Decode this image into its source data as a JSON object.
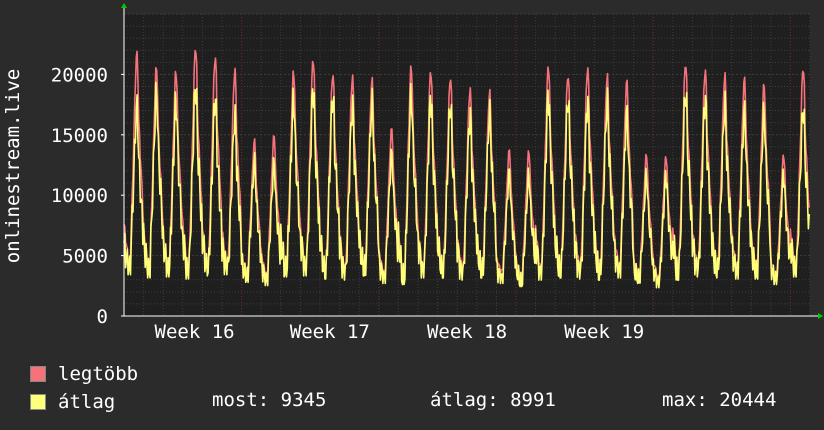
{
  "chart_data": {
    "type": "line",
    "ylabel": "onlinestream.live",
    "ylim": [
      0,
      25000
    ],
    "yticks": [
      0,
      5000,
      10000,
      15000,
      20000
    ],
    "x_tick_labels": [
      "Week 16",
      "Week 17",
      "Week 18",
      "Week 19"
    ],
    "grid": true,
    "days": 35,
    "series": [
      {
        "name": "legtöbb",
        "color": "#f5727b",
        "daily_peaks": [
          21700,
          20500,
          20200,
          22300,
          21500,
          20300,
          14500,
          14900,
          20200,
          21300,
          20100,
          19800,
          19500,
          15500,
          20600,
          20300,
          19800,
          18800,
          18500,
          13700,
          13600,
          20700,
          20000,
          20500,
          19800,
          19400,
          13300,
          13200,
          21000,
          20400,
          19900,
          19600,
          19100,
          13300,
          20600
        ],
        "daily_lows": [
          4500,
          4200,
          4100,
          4000,
          4300,
          4400,
          3700,
          3400,
          4200,
          4300,
          4000,
          3900,
          4400,
          3600,
          3500,
          4100,
          4200,
          4000,
          4200,
          3700,
          3300,
          4000,
          4100,
          4100,
          4000,
          4200,
          3600,
          3200,
          4000,
          4300,
          4200,
          4100,
          4100,
          3500,
          4200
        ]
      },
      {
        "name": "átlag",
        "color": "#ffff7a",
        "daily_peaks": [
          17300,
          18300,
          17600,
          19000,
          18100,
          16500,
          12700,
          12500,
          17800,
          18800,
          18200,
          17400,
          17600,
          13300,
          18100,
          18000,
          17500,
          16600,
          16700,
          11800,
          11500,
          18200,
          17800,
          17700,
          17600,
          16700,
          11500,
          11600,
          18500,
          18000,
          17400,
          16900,
          16700,
          11600,
          17200
        ],
        "daily_lows": [
          3800,
          3500,
          3600,
          3400,
          3700,
          3800,
          3100,
          2800,
          3600,
          3700,
          3400,
          3300,
          3700,
          3000,
          2900,
          3500,
          3500,
          3300,
          3500,
          3000,
          2700,
          3300,
          3500,
          3400,
          3300,
          3500,
          3000,
          2600,
          3300,
          3600,
          3500,
          3400,
          3400,
          2900,
          3600
        ]
      }
    ]
  },
  "legend": {
    "max_label": "legtöbb",
    "avg_label": "átlag",
    "max_color": "#f5727b",
    "avg_color": "#ffff7a"
  },
  "stats": {
    "now": "most: 9345",
    "avg": "átlag: 8991",
    "max": "max: 20444"
  }
}
